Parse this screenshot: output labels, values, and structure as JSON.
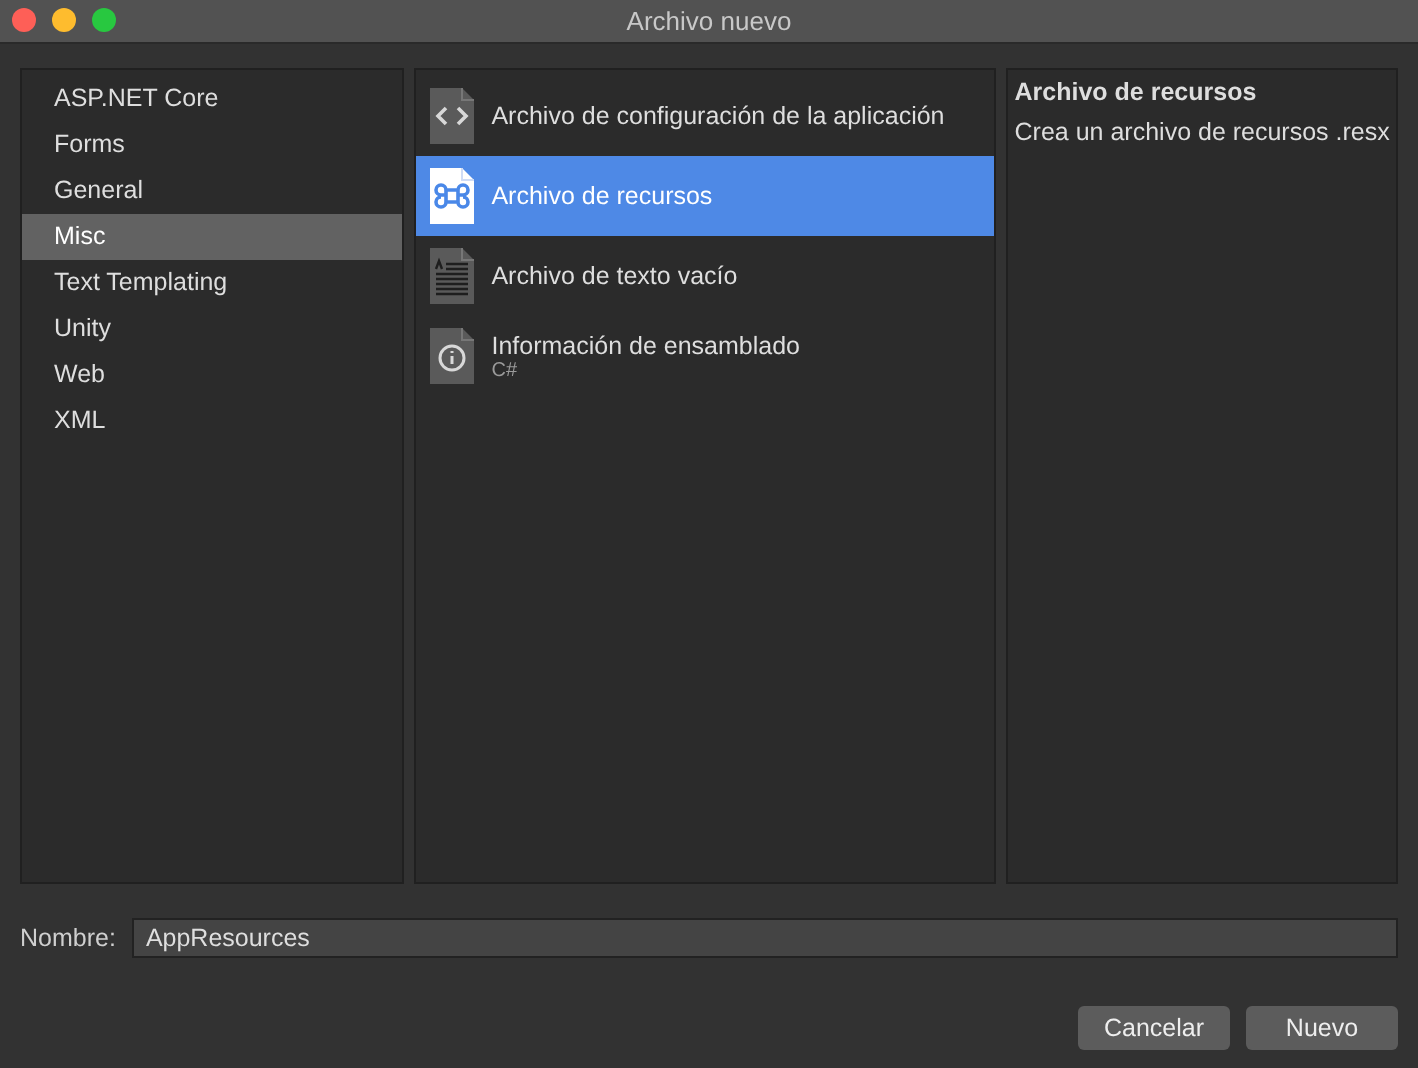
{
  "window": {
    "title": "Archivo nuevo"
  },
  "categories": [
    {
      "label": "ASP.NET Core",
      "selected": false
    },
    {
      "label": "Forms",
      "selected": false
    },
    {
      "label": "General",
      "selected": false
    },
    {
      "label": "Misc",
      "selected": true
    },
    {
      "label": "Text Templating",
      "selected": false
    },
    {
      "label": "Unity",
      "selected": false
    },
    {
      "label": "Web",
      "selected": false
    },
    {
      "label": "XML",
      "selected": false
    }
  ],
  "templates": [
    {
      "kind": "code",
      "label": "Archivo de configuración de la aplicación",
      "selected": false
    },
    {
      "kind": "command",
      "label": "Archivo de recursos",
      "selected": true
    },
    {
      "kind": "text",
      "label": "Archivo de texto vacío",
      "selected": false
    },
    {
      "kind": "info",
      "label": "Información de ensamblado",
      "sublabel": "C#",
      "selected": false
    }
  ],
  "description": {
    "title": "Archivo de recursos",
    "text": "Crea un archivo de recursos .resx"
  },
  "name_field": {
    "label": "Nombre:",
    "value": "AppResources"
  },
  "buttons": [
    "Cancelar",
    "Nuevo"
  ]
}
